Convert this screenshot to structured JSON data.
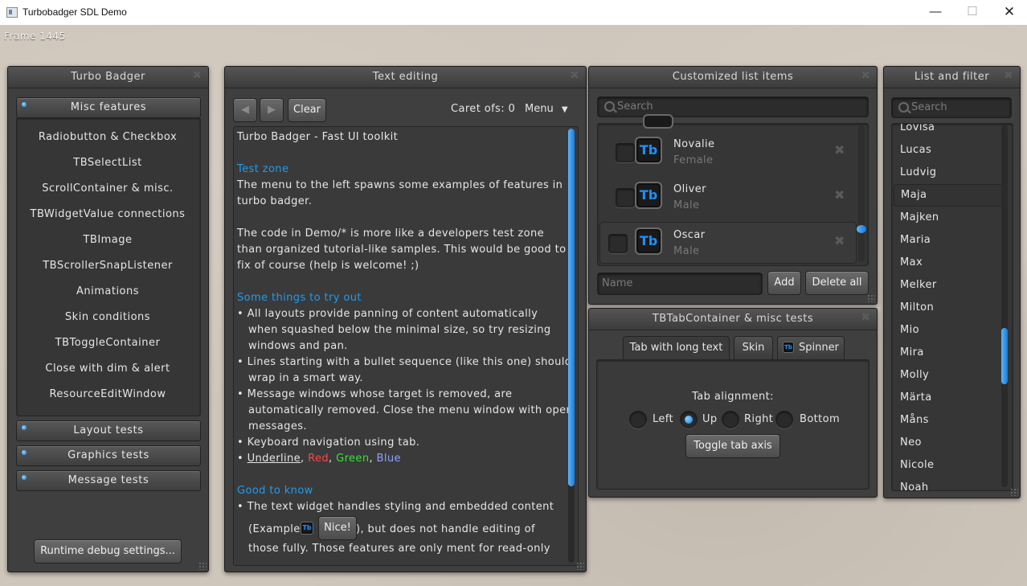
{
  "app": {
    "title": "Turbobadger SDL Demo",
    "frame_text": "Frame 1445"
  },
  "window_controls": {
    "minimize": "—",
    "maximize": "☐",
    "close": "✕"
  },
  "turbo_badger": {
    "title": "Turbo Badger",
    "misc_features": "Misc features",
    "menu": [
      "Radiobutton & Checkbox",
      "TBSelectList",
      "ScrollContainer & misc.",
      "TBWidgetValue connections",
      "TBImage",
      "TBScrollerSnapListener",
      "Animations",
      "Skin conditions",
      "TBToggleContainer",
      "Close with dim & alert",
      "ResourceEditWindow"
    ],
    "layout_tests": "Layout tests",
    "graphics_tests": "Graphics tests",
    "message_tests": "Message tests",
    "runtime_debug": "Runtime debug settings..."
  },
  "text_editing": {
    "title": "Text editing",
    "clear": "Clear",
    "caret": "Caret ofs: 0",
    "menu": "Menu",
    "lines": {
      "l1": "Turbo Badger - Fast UI toolkit",
      "h1": "Test zone",
      "l2": "The menu to the left spawns some examples of features in",
      "l3": "turbo badger.",
      "l4": "The code in Demo/* is more like a developers test zone",
      "l5": "than organized tutorial-like samples. This would be good to",
      "l6": "fix of course (help is welcome! ;)",
      "h2": "Some things to try out",
      "b1a": "• All layouts provide panning of content automatically",
      "b1b": "when squashed below the minimal size, so try resizing",
      "b1c": "windows and pan.",
      "b2a": "• Lines starting with a bullet sequence (like this one) should",
      "b2b": "wrap in a smart way.",
      "b3a": "• Message windows whose target is removed, are",
      "b3b": "automatically removed. Close the menu window with open",
      "b3c": "messages.",
      "b4": "• Keyboard navigation using tab.",
      "b5_bullet": "• ",
      "b5_underline": "Underline",
      "b5_red": "Red",
      "b5_green": "Green",
      "b5_blue": "Blue",
      "sep": ", ",
      "h3": "Good to know",
      "g1": "• The text widget handles styling and embedded content",
      "g2a": "(Example: ",
      "g2_button": "Nice!",
      "g2b": "), but does not handle editing of",
      "g3": "those fully. Those features are only ment for read-only"
    },
    "scroll_fraction": 0.0
  },
  "custom_list": {
    "title": "Customized list items",
    "search_placeholder": "Search",
    "items": [
      {
        "name": "Novalie",
        "gender": "Female"
      },
      {
        "name": "Oliver",
        "gender": "Male"
      },
      {
        "name": "Oscar",
        "gender": "Male"
      }
    ],
    "icon_text": "Tb",
    "name_placeholder": "Name",
    "add": "Add",
    "delete_all": "Delete all"
  },
  "tab_container": {
    "title": "TBTabContainer & misc tests",
    "tabs": [
      "Tab with long text",
      "Skin",
      "Spinner"
    ],
    "alignment_label": "Tab alignment:",
    "radios": [
      "Left",
      "Up",
      "Right",
      "Bottom"
    ],
    "selected_radio": "Up",
    "toggle_axis": "Toggle tab axis"
  },
  "list_filter": {
    "title": "List and filter",
    "search_placeholder": "Search",
    "items": [
      "Lovisa",
      "Lucas",
      "Ludvig",
      "Maja",
      "Majken",
      "Maria",
      "Max",
      "Melker",
      "Milton",
      "Mio",
      "Mira",
      "Molly",
      "Märta",
      "Måns",
      "Neo",
      "Nicole",
      "Noah"
    ],
    "selected": "Maja"
  },
  "colors": {
    "accent": "#1e9cf0",
    "panel": "#3f3f3f"
  }
}
